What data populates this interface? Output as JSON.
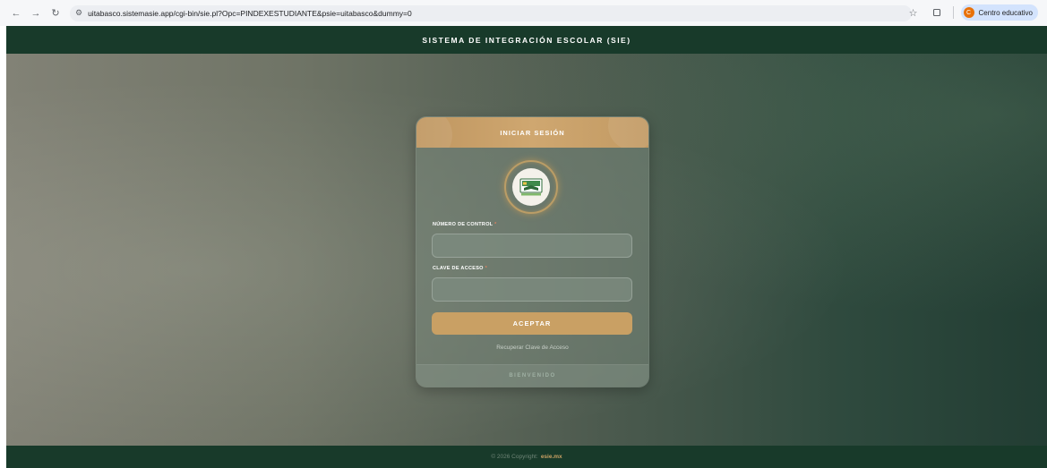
{
  "browser": {
    "url": "uitabasco.sistemasie.app/cgi-bin/sie.pl?Opc=PINDEXESTUDIANTE&psie=uitabasco&dummy=0",
    "profile_label": "Centro educativo",
    "profile_initial": "C",
    "icons": {
      "back": "back-arrow-icon",
      "forward": "forward-arrow-icon",
      "reload": "reload-icon",
      "site_info": "tune-icon",
      "bookmark": "star-icon",
      "extensions": "extensions-icon"
    }
  },
  "header": {
    "title": "SISTEMA DE INTEGRACIÓN ESCOLAR (SIE)"
  },
  "login": {
    "title": "INICIAR SESIÓN",
    "control_label": "NÚMERO DE CONTROL",
    "password_label": "CLAVE DE ACCESO",
    "required_mark": "*",
    "control_value": "",
    "password_value": "",
    "accept_label": "ACEPTAR",
    "recover_link": "Recuperar Clave de Acceso",
    "footer": "BIENVENIDO"
  },
  "footer": {
    "copyright": "© 2026 Copyright:",
    "brand": "esie.mx"
  },
  "colors": {
    "bar": "#183a2a",
    "accent": "#c9a064"
  }
}
